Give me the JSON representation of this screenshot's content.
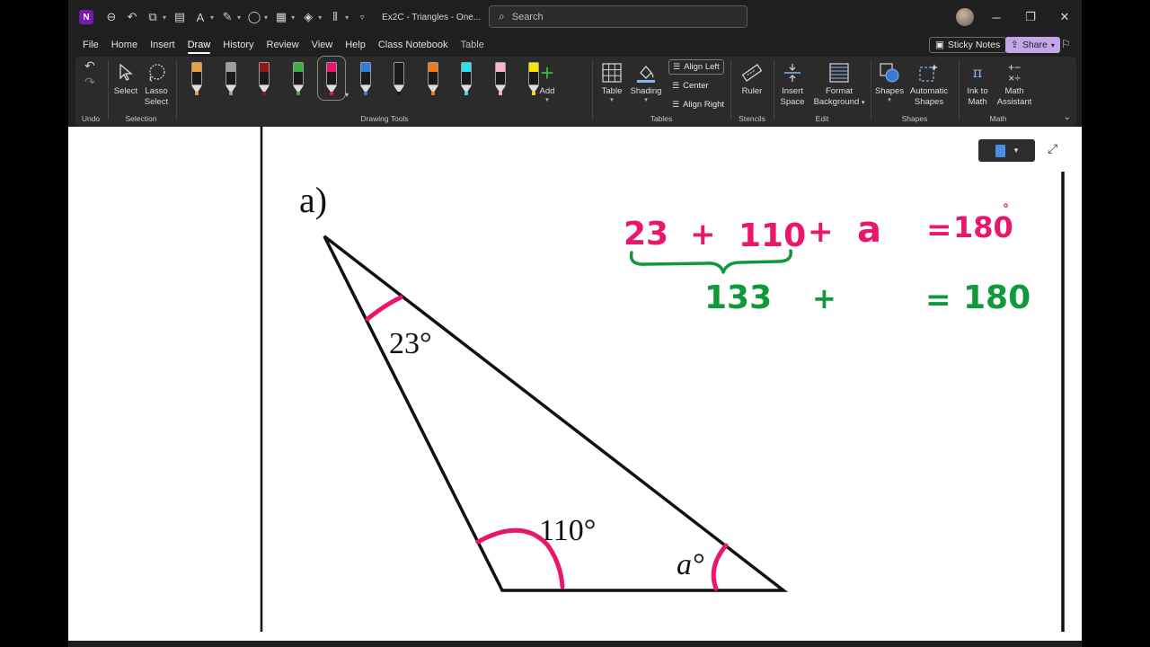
{
  "title_bar": {
    "app_logo": "N",
    "doc_title": "Ex2C - Triangles  -  One...",
    "search_placeholder": "Search",
    "win_controls": {
      "minimize": "─",
      "restore": "❐",
      "close": "✕"
    }
  },
  "menu": {
    "tabs": [
      "File",
      "Home",
      "Insert",
      "Draw",
      "History",
      "Review",
      "View",
      "Help",
      "Class Notebook",
      "Table"
    ],
    "active": "Draw",
    "sticky_notes": "Sticky Notes",
    "share": "Share"
  },
  "ribbon": {
    "undo_group": "Undo",
    "selection_group": "Selection",
    "select": "Select",
    "lasso_line1": "Lasso",
    "lasso_line2": "Select",
    "drawing_tools_group": "Drawing Tools",
    "add": "Add",
    "tables_group": "Tables",
    "table": "Table",
    "shading": "Shading",
    "align_left": "Align Left",
    "center": "Center",
    "align_right": "Align Right",
    "stencils_group": "Stencils",
    "ruler": "Ruler",
    "edit_group": "Edit",
    "insert_space_line1": "Insert",
    "insert_space_line2": "Space",
    "format_bg_line1": "Format",
    "format_bg_line2": "Background",
    "shapes_group": "Shapes",
    "shapes": "Shapes",
    "auto_shapes_line1": "Automatic",
    "auto_shapes_line2": "Shapes",
    "math_group": "Math",
    "ink_to_math_line1": "Ink to",
    "ink_to_math_line2": "Math",
    "math_assistant_line1": "Math",
    "math_assistant_line2": "Assistant",
    "pen_colors": [
      "#e8a040",
      "#9e9e9e",
      "#8b1a1a",
      "#3cb043",
      "#e8176b",
      "#2f7fd8",
      "#1a1a1a",
      "#f07a20",
      "#2fe0f0",
      "#f8b4c8",
      "#f5e600"
    ],
    "selected_pen": 4
  },
  "page": {
    "problem_label": "a)",
    "angle_top": "23°",
    "angle_bottom_left": "110°",
    "angle_bottom_right": "a°",
    "ink_line1": {
      "t1": "23",
      "plus1": "+",
      "t2": "110",
      "plus2": "+",
      "t3": "a",
      "eq": "=",
      "t4": "180",
      "deg": "°"
    },
    "ink_line2": {
      "t1": "133",
      "plus": "+",
      "eq": "=",
      "t2": "180"
    }
  },
  "colors": {
    "ink_pink": "#e8176b",
    "ink_green": "#0e9a3a",
    "accent_share": "#c3a6e8"
  }
}
